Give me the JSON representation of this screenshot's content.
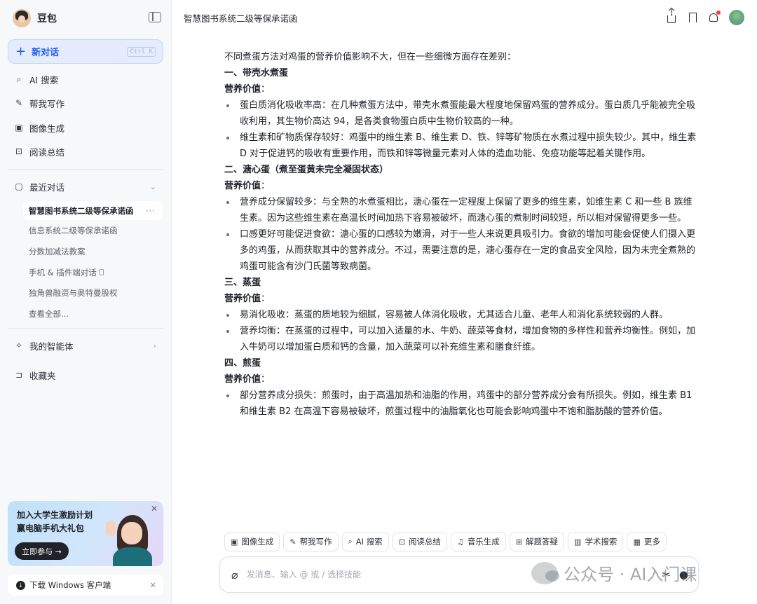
{
  "sidebar": {
    "brand": "豆包",
    "new_chat": {
      "label": "新对话",
      "shortcut": "Ctrl K"
    },
    "nav": [
      {
        "label": "AI 搜索",
        "icon": "search-icon"
      },
      {
        "label": "帮我写作",
        "icon": "pen-icon"
      },
      {
        "label": "图像生成",
        "icon": "image-icon"
      },
      {
        "label": "阅读总结",
        "icon": "read-icon"
      }
    ],
    "recent": {
      "label": "最近对话",
      "items": [
        "智慧图书系统二级等保承诺函",
        "信息系统二级等保承诺函",
        "分数加减法教案",
        "手机 & 插件端对话",
        "独角兽融资与奥特曼股权",
        "查看全部..."
      ]
    },
    "agents": "我的智能体",
    "favorites": "收藏夹",
    "promo": {
      "line1": "加入大学生激励计划",
      "line2": "赢电脑手机大礼包",
      "button": "立即参与 →"
    },
    "download": "下载 Windows 客户端"
  },
  "header": {
    "title": "智慧图书系统二级等保承诺函"
  },
  "message": {
    "intro": "不同煮蛋方法对鸡蛋的营养价值影响不大，但在一些细微方面存在差别：",
    "s1": {
      "title": "一、带壳水煮蛋",
      "label": "营养价值",
      "b1": "蛋白质消化吸收率高：在几种煮蛋方法中，带壳水煮蛋能最大程度地保留鸡蛋的营养成分。蛋白质几乎能被完全吸收利用，其生物价高达 94，是各类食物蛋白质中生物价较高的一种。",
      "b2": "维生素和矿物质保存较好：鸡蛋中的维生素 B、维生素 D、铁、锌等矿物质在水煮过程中损失较少。其中，维生素 D 对于促进钙的吸收有重要作用，而铁和锌等微量元素对人体的造血功能、免疫功能等起着关键作用。"
    },
    "s2": {
      "title": "二、溏心蛋（煮至蛋黄未完全凝固状态）",
      "label": "营养价值",
      "b1": "营养成分保留较多：与全熟的水煮蛋相比，溏心蛋在一定程度上保留了更多的维生素，如维生素 C 和一些 B 族维生素。因为这些维生素在高温长时间加热下容易被破坏，而溏心蛋的煮制时间较短，所以相对保留得更多一些。",
      "b2": "口感更好可能促进食欲：溏心蛋的口感较为嫩滑，对于一些人来说更具吸引力。食欲的增加可能会促使人们摄入更多的鸡蛋，从而获取其中的营养成分。不过，需要注意的是，溏心蛋存在一定的食品安全风险，因为未完全煮熟的鸡蛋可能含有沙门氏菌等致病菌。"
    },
    "s3": {
      "title": "三、蒸蛋",
      "label": "营养价值",
      "b1": "易消化吸收：蒸蛋的质地较为细腻，容易被人体消化吸收，尤其适合儿童、老年人和消化系统较弱的人群。",
      "b2": "营养均衡：在蒸蛋的过程中，可以加入适量的水、牛奶、蔬菜等食材，增加食物的多样性和营养均衡性。例如，加入牛奶可以增加蛋白质和钙的含量，加入蔬菜可以补充维生素和膳食纤维。"
    },
    "s4": {
      "title": "四、煎蛋",
      "label": "营养价值",
      "b1": "部分营养成分损失：煎蛋时，由于高温加热和油脂的作用，鸡蛋中的部分营养成分会有所损失。例如，维生素 B1 和维生素 B2 在高温下容易被破坏，煎蛋过程中的油脂氧化也可能会影响鸡蛋中不饱和脂肪酸的营养价值。"
    }
  },
  "chips": [
    {
      "label": "图像生成",
      "icon": "image-icon"
    },
    {
      "label": "帮我写作",
      "icon": "pen-icon"
    },
    {
      "label": "AI 搜索",
      "icon": "search-icon"
    },
    {
      "label": "阅读总结",
      "icon": "read-icon"
    },
    {
      "label": "音乐生成",
      "icon": "music-icon"
    },
    {
      "label": "解题答疑",
      "icon": "solve-icon"
    },
    {
      "label": "学术搜索",
      "icon": "academic-icon"
    },
    {
      "label": "更多",
      "icon": "grid-icon"
    }
  ],
  "input": {
    "placeholder": "发消息、输入 @ 或 / 选择技能"
  },
  "watermark": "公众号 · AI入门课",
  "colors": {
    "accent": "#1e5cf0",
    "notification": "#f23d3d"
  }
}
